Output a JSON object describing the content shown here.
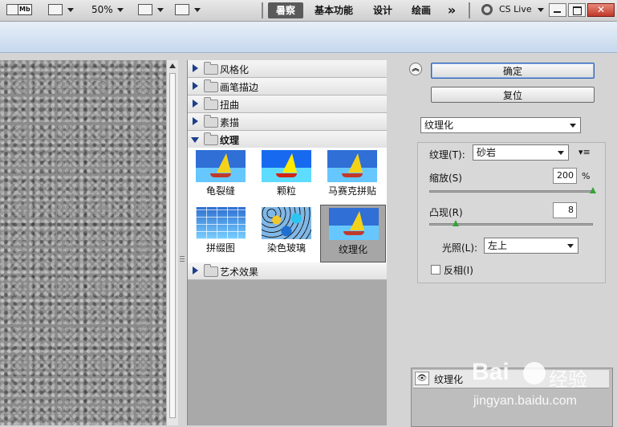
{
  "topbar": {
    "mb_label": "Mb",
    "zoom": "50%",
    "workspaces": [
      "暑察",
      "基本功能",
      "设计",
      "绘画"
    ],
    "more": "»",
    "cs_live": "CS Live"
  },
  "gallery": {
    "categories": [
      {
        "label": "风格化"
      },
      {
        "label": "画笔描边"
      },
      {
        "label": "扭曲"
      },
      {
        "label": "素描"
      },
      {
        "label": "纹理"
      },
      {
        "label": "艺术效果"
      }
    ],
    "thumbs": [
      {
        "label": "龟裂缝"
      },
      {
        "label": "颗粒"
      },
      {
        "label": "马赛克拼贴"
      },
      {
        "label": "拼缀图"
      },
      {
        "label": "染色玻璃"
      },
      {
        "label": "纹理化"
      }
    ]
  },
  "controls": {
    "ok_label": "确定",
    "reset_label": "复位",
    "filter_select": "纹理化",
    "texture_label": "纹理(T):",
    "texture_value": "砂岩",
    "scale_label": "缩放(S)",
    "scale_value": "200",
    "scale_unit": "%",
    "scale_level": 1.0,
    "relief_label": "凸现(R)",
    "relief_value": "8",
    "relief_level": 0.16,
    "light_label": "光照(L):",
    "light_value": "左上",
    "invert_label": "反相(I)",
    "layer_name": "纹理化"
  },
  "colors": {
    "accent": "#2b5fb3",
    "slider_knob": "#36a236"
  },
  "watermark": {
    "brand": "Bai",
    "brand_suffix": "经验",
    "url": "jingyan.baidu.com"
  }
}
